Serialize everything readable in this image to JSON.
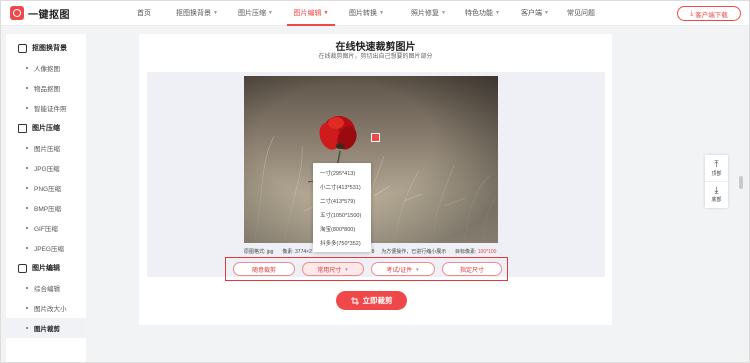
{
  "header": {
    "logo_text": "一键抠图",
    "nav": [
      {
        "label": "首页",
        "dropdown": false
      },
      {
        "label": "抠图换背景",
        "dropdown": true
      },
      {
        "label": "图片压缩",
        "dropdown": true
      },
      {
        "label": "图片编辑",
        "dropdown": true,
        "active": true
      },
      {
        "label": "图片转换",
        "dropdown": true
      },
      {
        "label": "照片修复",
        "dropdown": true
      },
      {
        "label": "特色功能",
        "dropdown": true
      },
      {
        "label": "客户端",
        "dropdown": true
      },
      {
        "label": "常见问题",
        "dropdown": false
      }
    ],
    "download_label": "客户端下载",
    "accent_color": "#f04848"
  },
  "sidebar": {
    "groups": [
      {
        "label": "抠图换背景",
        "icon": "image-cutout-icon",
        "items": [
          "人像抠图",
          "物品抠图",
          "智能证件照"
        ]
      },
      {
        "label": "图片压缩",
        "icon": "compress-icon",
        "items": [
          "图片压缩",
          "JPG压缩",
          "PNG压缩",
          "BMP压缩",
          "GIF压缩",
          "JPEG压缩"
        ]
      },
      {
        "label": "图片编辑",
        "icon": "edit-icon",
        "items": [
          "综合编辑",
          "图片改大小",
          "图片裁剪"
        ]
      }
    ],
    "active_item": "图片裁剪"
  },
  "main": {
    "title": "在线快速裁剪图片",
    "subtitle": "在线裁剪图片，剪切出自己想要的图片部分",
    "size_menu": [
      "一寸(295*413)",
      "小二寸(413*531)",
      "二寸(413*579)",
      "五寸(1050*1500)",
      "淘宝(800*800)",
      "抖多多(750*352)"
    ],
    "info": {
      "format_label": "原图格式:",
      "format_value": "jpg",
      "pixel_label": "像素:",
      "pixel_value": "3774×2",
      "hidden_tail": "8",
      "hint": "为方便操作，已进行缩小展示",
      "target_label": "目标像素:",
      "target_value": "100*100"
    },
    "buttons": [
      {
        "label": "随意裁剪",
        "dropdown": false
      },
      {
        "label": "常用尺寸",
        "dropdown": true,
        "pressed": true
      },
      {
        "label": "考试/证件",
        "dropdown": true
      },
      {
        "label": "指定尺寸",
        "dropdown": false
      }
    ],
    "crop_button": "立即裁剪"
  },
  "float": {
    "top_label": "顶部",
    "bottom_label": "底部"
  }
}
